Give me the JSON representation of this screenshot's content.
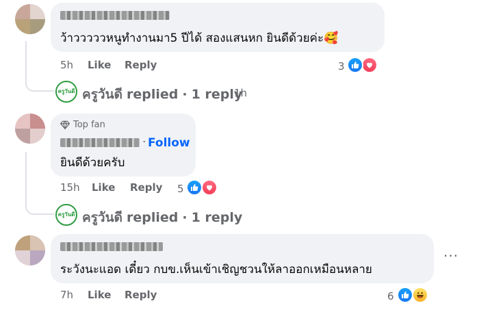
{
  "comments": [
    {
      "text": "ว้าวววววหนูทำงานมา5 ปีได้ สองแสนหก ยินดีด้วยค่ะ🥰",
      "time": "5h",
      "like_label": "Like",
      "reply_label": "Reply",
      "reaction_count": "3",
      "reactions": [
        "like-icon",
        "love-icon"
      ],
      "replied": {
        "avatar_text": "ครูวันดี",
        "name": "ครูวันดี",
        "replied_text": "replied",
        "separator": "·",
        "count_text": "1 reply",
        "time": "1h"
      }
    },
    {
      "badge": "Top fan",
      "follow_label": "Follow",
      "separator": "·",
      "text": "ยินดีด้วยครับ",
      "time": "15h",
      "like_label": "Like",
      "reply_label": "Reply",
      "reaction_count": "5",
      "reactions": [
        "like-icon",
        "love-icon"
      ],
      "replied": {
        "avatar_text": "ครูวันดี",
        "name": "ครูวันดี",
        "replied_text": "replied",
        "separator": "·",
        "count_text": "1 reply"
      }
    },
    {
      "text": "ระวังนะแอด เดี๋ยว กบข.เห็นเข้าเชิญชวนให้ลาออกเหมือนหลาย",
      "time": "7h",
      "like_label": "Like",
      "reply_label": "Reply",
      "reaction_count": "6",
      "reactions": [
        "like-icon",
        "haha-icon"
      ],
      "more_label": "···"
    }
  ],
  "colors": {
    "bubble": "#f0f2f5",
    "meta_text": "#65676b",
    "link_blue": "#0866ff",
    "like_blue": "#1877f2",
    "love_red": "#f33e58",
    "haha_yellow": "#f7b125",
    "avatar_green": "#2e9c41"
  }
}
